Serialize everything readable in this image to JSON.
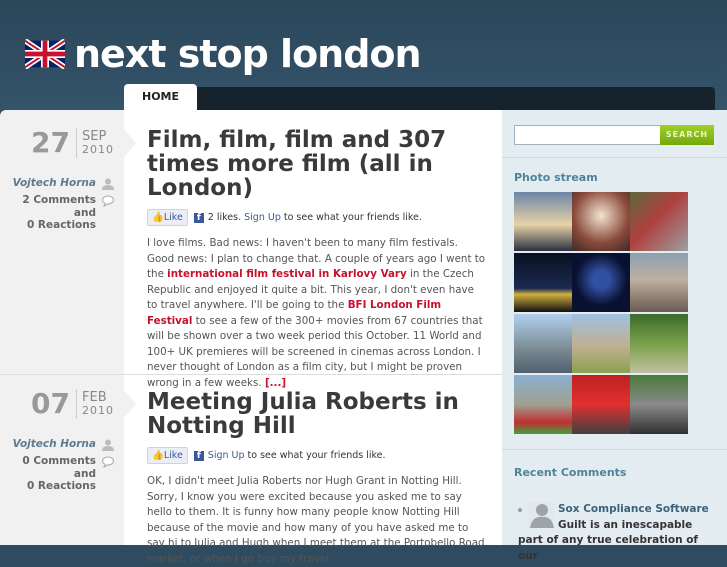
{
  "site": {
    "title": "next stop london"
  },
  "nav": {
    "home": "HOME"
  },
  "posts": [
    {
      "day": "27",
      "month": "SEP",
      "year": "2010",
      "author": "Vojtech Horna",
      "comments": "2 Comments and",
      "reactions": "0 Reactions",
      "title": "Film, film, film and 307 times more film (all in London)",
      "like": "Like",
      "likes_count": "2 likes.",
      "signup": "Sign Up",
      "friends": "to see what your friends like.",
      "body": {
        "p1": "I love films. Bad news: I haven't been to many film festivals. Good news: I plan to change that. A couple of years ago I went to the ",
        "link1": "international film festival in Karlovy Vary",
        "p2": " in the Czech Republic and enjoyed it quite a bit. This year, I don't even have to travel anywhere. I'll be going to the ",
        "link2": "BFI London Film Festival",
        "p3": " to see a few of the 300+ movies from 67 countries that will be shown over a two week period this October. 11 World and 100+ UK premieres will be screened in cinemas across London. I never thought of London as a film city, but I might be proven wrong in a few weeks. ",
        "more": "[...]"
      }
    },
    {
      "day": "07",
      "month": "FEB",
      "year": "2010",
      "author": "Vojtech Horna",
      "comments": "0 Comments and",
      "reactions": "0 Reactions",
      "title": "Meeting Julia Roberts in Notting Hill",
      "like": "Like",
      "signup": "Sign Up",
      "friends": "to see what your friends like.",
      "body": "OK, I didn't meet Julia Roberts nor Hugh Grant in Notting Hill. Sorry, I know you were excited because you asked me to say hello to them. It is funny how many people know Notting Hill because of the movie and how many of you have asked me to say hi to Julia and Hugh when I meet them at the Portobello Road market, or when I go buy my travel"
    }
  ],
  "sidebar": {
    "search_placeholder": "",
    "search_button": "SEARCH",
    "photo_stream": "Photo stream",
    "recent_comments": "Recent Comments",
    "comment": {
      "author": "Sox Compliance Software",
      "text": "Guilt is an inescapable part of any true celebration of our"
    }
  },
  "colors": {
    "header": "#2f4b5f",
    "accent": "#c8102e",
    "search": "#8cc11c"
  }
}
